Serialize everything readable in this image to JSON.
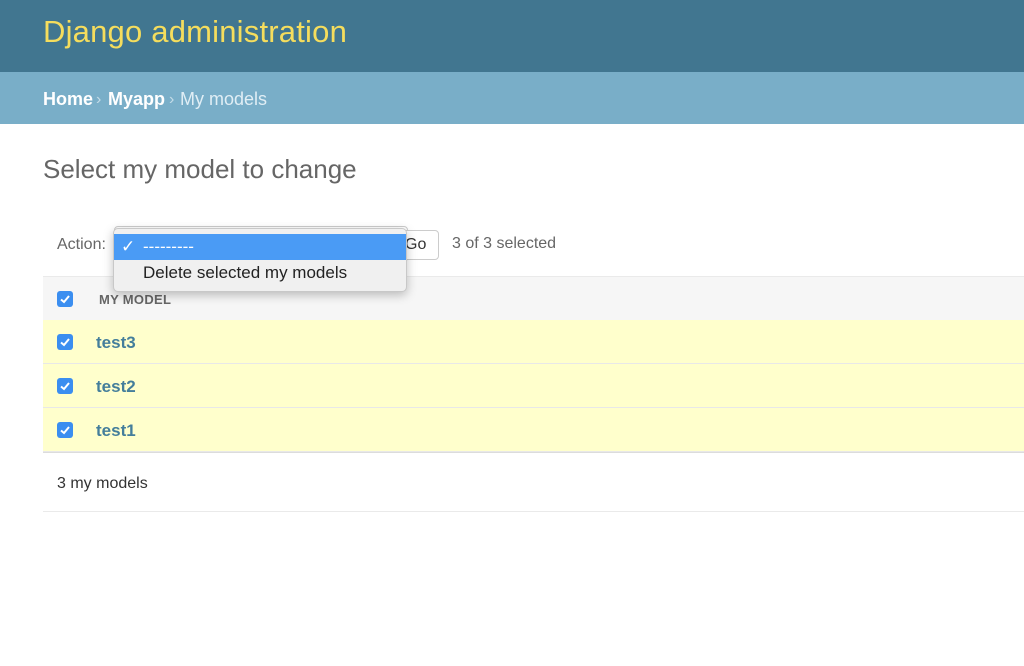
{
  "header": {
    "site_title": "Django administration"
  },
  "breadcrumbs": {
    "home": "Home",
    "app": "Myapp",
    "current": "My models",
    "separator": "›"
  },
  "page_title": "Select my model to change",
  "actions": {
    "label": "Action:",
    "selected_value": "---------",
    "options": [
      {
        "label": "---------",
        "checked": true
      },
      {
        "label": "Delete selected my models",
        "checked": false
      }
    ],
    "check_mark": "✓",
    "go_label": "Go",
    "selected_count": "3 of 3 selected"
  },
  "table": {
    "column_header": "MY MODEL",
    "select_all_checked": true,
    "rows": [
      {
        "name": "test3",
        "checked": true
      },
      {
        "name": "test2",
        "checked": true
      },
      {
        "name": "test1",
        "checked": true
      }
    ]
  },
  "paginator": {
    "count_text": "3 my models"
  },
  "colors": {
    "header_bg": "#417690",
    "site_title": "#f5dd5d",
    "breadcrumb_bg": "#79aec8",
    "selected_row_bg": "#ffffcc",
    "link": "#447e9b",
    "dropdown_highlight": "#4a9bf5"
  }
}
